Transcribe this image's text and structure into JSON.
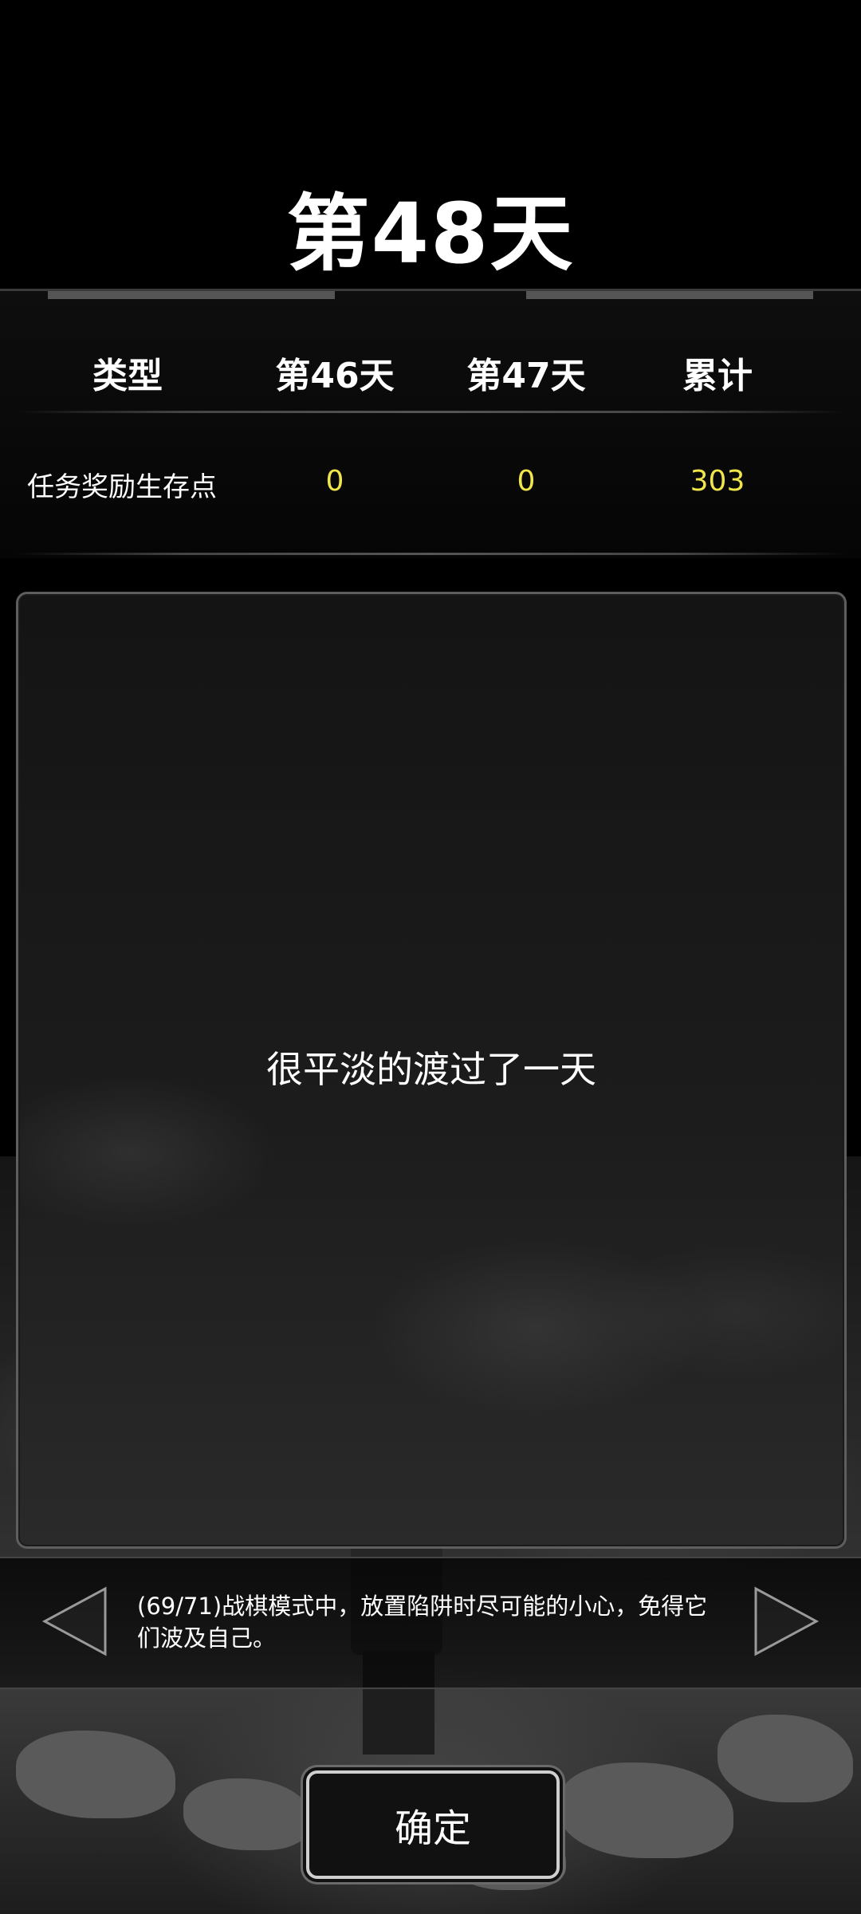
{
  "header": {
    "day_title": "第48天"
  },
  "stats": {
    "columns": [
      "类型",
      "第46天",
      "第47天",
      "累计"
    ],
    "rows": [
      {
        "label": "任务奖励生存点",
        "day46": "0",
        "day47": "0",
        "total": "303"
      }
    ],
    "value_color": "#f0e64a"
  },
  "message": {
    "text": "很平淡的渡过了一天"
  },
  "tip": {
    "text": "(69/71)战棋模式中，放置陷阱时尽可能的小心，免得它们波及自己。"
  },
  "navigation": {
    "prev_icon": "triangle-left-icon",
    "next_icon": "triangle-right-icon"
  },
  "actions": {
    "confirm_label": "确定"
  }
}
